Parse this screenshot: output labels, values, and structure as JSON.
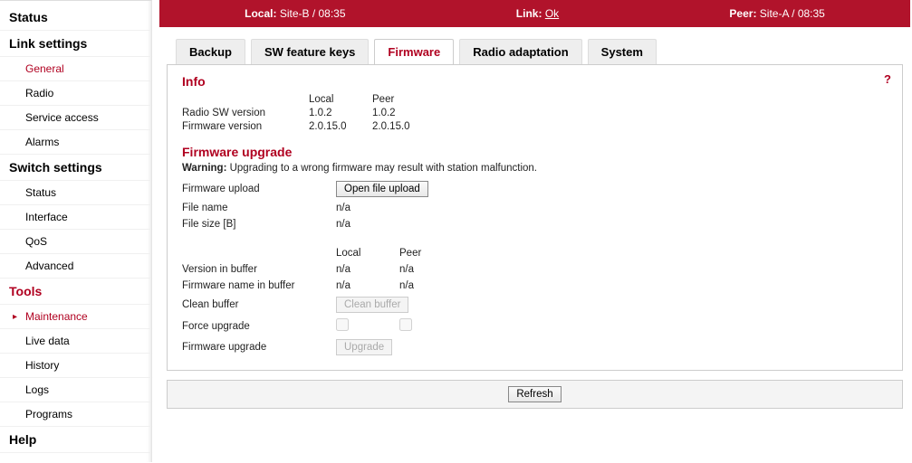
{
  "sidebar": {
    "status": "Status",
    "link_settings": "Link settings",
    "link_items": [
      "General",
      "Radio",
      "Service access",
      "Alarms"
    ],
    "switch_settings": "Switch settings",
    "switch_items": [
      "Status",
      "Interface",
      "QoS",
      "Advanced"
    ],
    "tools": "Tools",
    "tools_items": [
      "Maintenance",
      "Live data",
      "History",
      "Logs",
      "Programs"
    ],
    "help": "Help"
  },
  "statusbar": {
    "local_label": "Local:",
    "local_value": "Site-B / 08:35",
    "link_label": "Link:",
    "link_value": "Ok",
    "peer_label": "Peer:",
    "peer_value": "Site-A / 08:35"
  },
  "tabs": {
    "backup": "Backup",
    "sw_keys": "SW feature keys",
    "firmware": "Firmware",
    "radio_adapt": "Radio adaptation",
    "system": "System"
  },
  "info": {
    "title": "Info",
    "local_hdr": "Local",
    "peer_hdr": "Peer",
    "radio_sw_label": "Radio SW version",
    "radio_sw_local": "1.0.2",
    "radio_sw_peer": "1.0.2",
    "fw_label": "Firmware version",
    "fw_local": "2.0.15.0",
    "fw_peer": "2.0.15.0"
  },
  "upgrade": {
    "title": "Firmware upgrade",
    "warning_label": "Warning:",
    "warning_text": "Upgrading to a wrong firmware may result with station malfunction.",
    "upload_label": "Firmware upload",
    "open_btn": "Open file upload",
    "file_name_label": "File name",
    "file_name_val": "n/a",
    "file_size_label": "File size [B]",
    "file_size_val": "n/a",
    "local_hdr": "Local",
    "peer_hdr": "Peer",
    "ver_buf_label": "Version in buffer",
    "ver_buf_local": "n/a",
    "ver_buf_peer": "n/a",
    "name_buf_label": "Firmware name in buffer",
    "name_buf_local": "n/a",
    "name_buf_peer": "n/a",
    "clean_label": "Clean buffer",
    "clean_btn": "Clean buffer",
    "force_label": "Force upgrade",
    "upgrade_label": "Firmware upgrade",
    "upgrade_btn": "Upgrade"
  },
  "refresh": "Refresh",
  "help_q": "?"
}
